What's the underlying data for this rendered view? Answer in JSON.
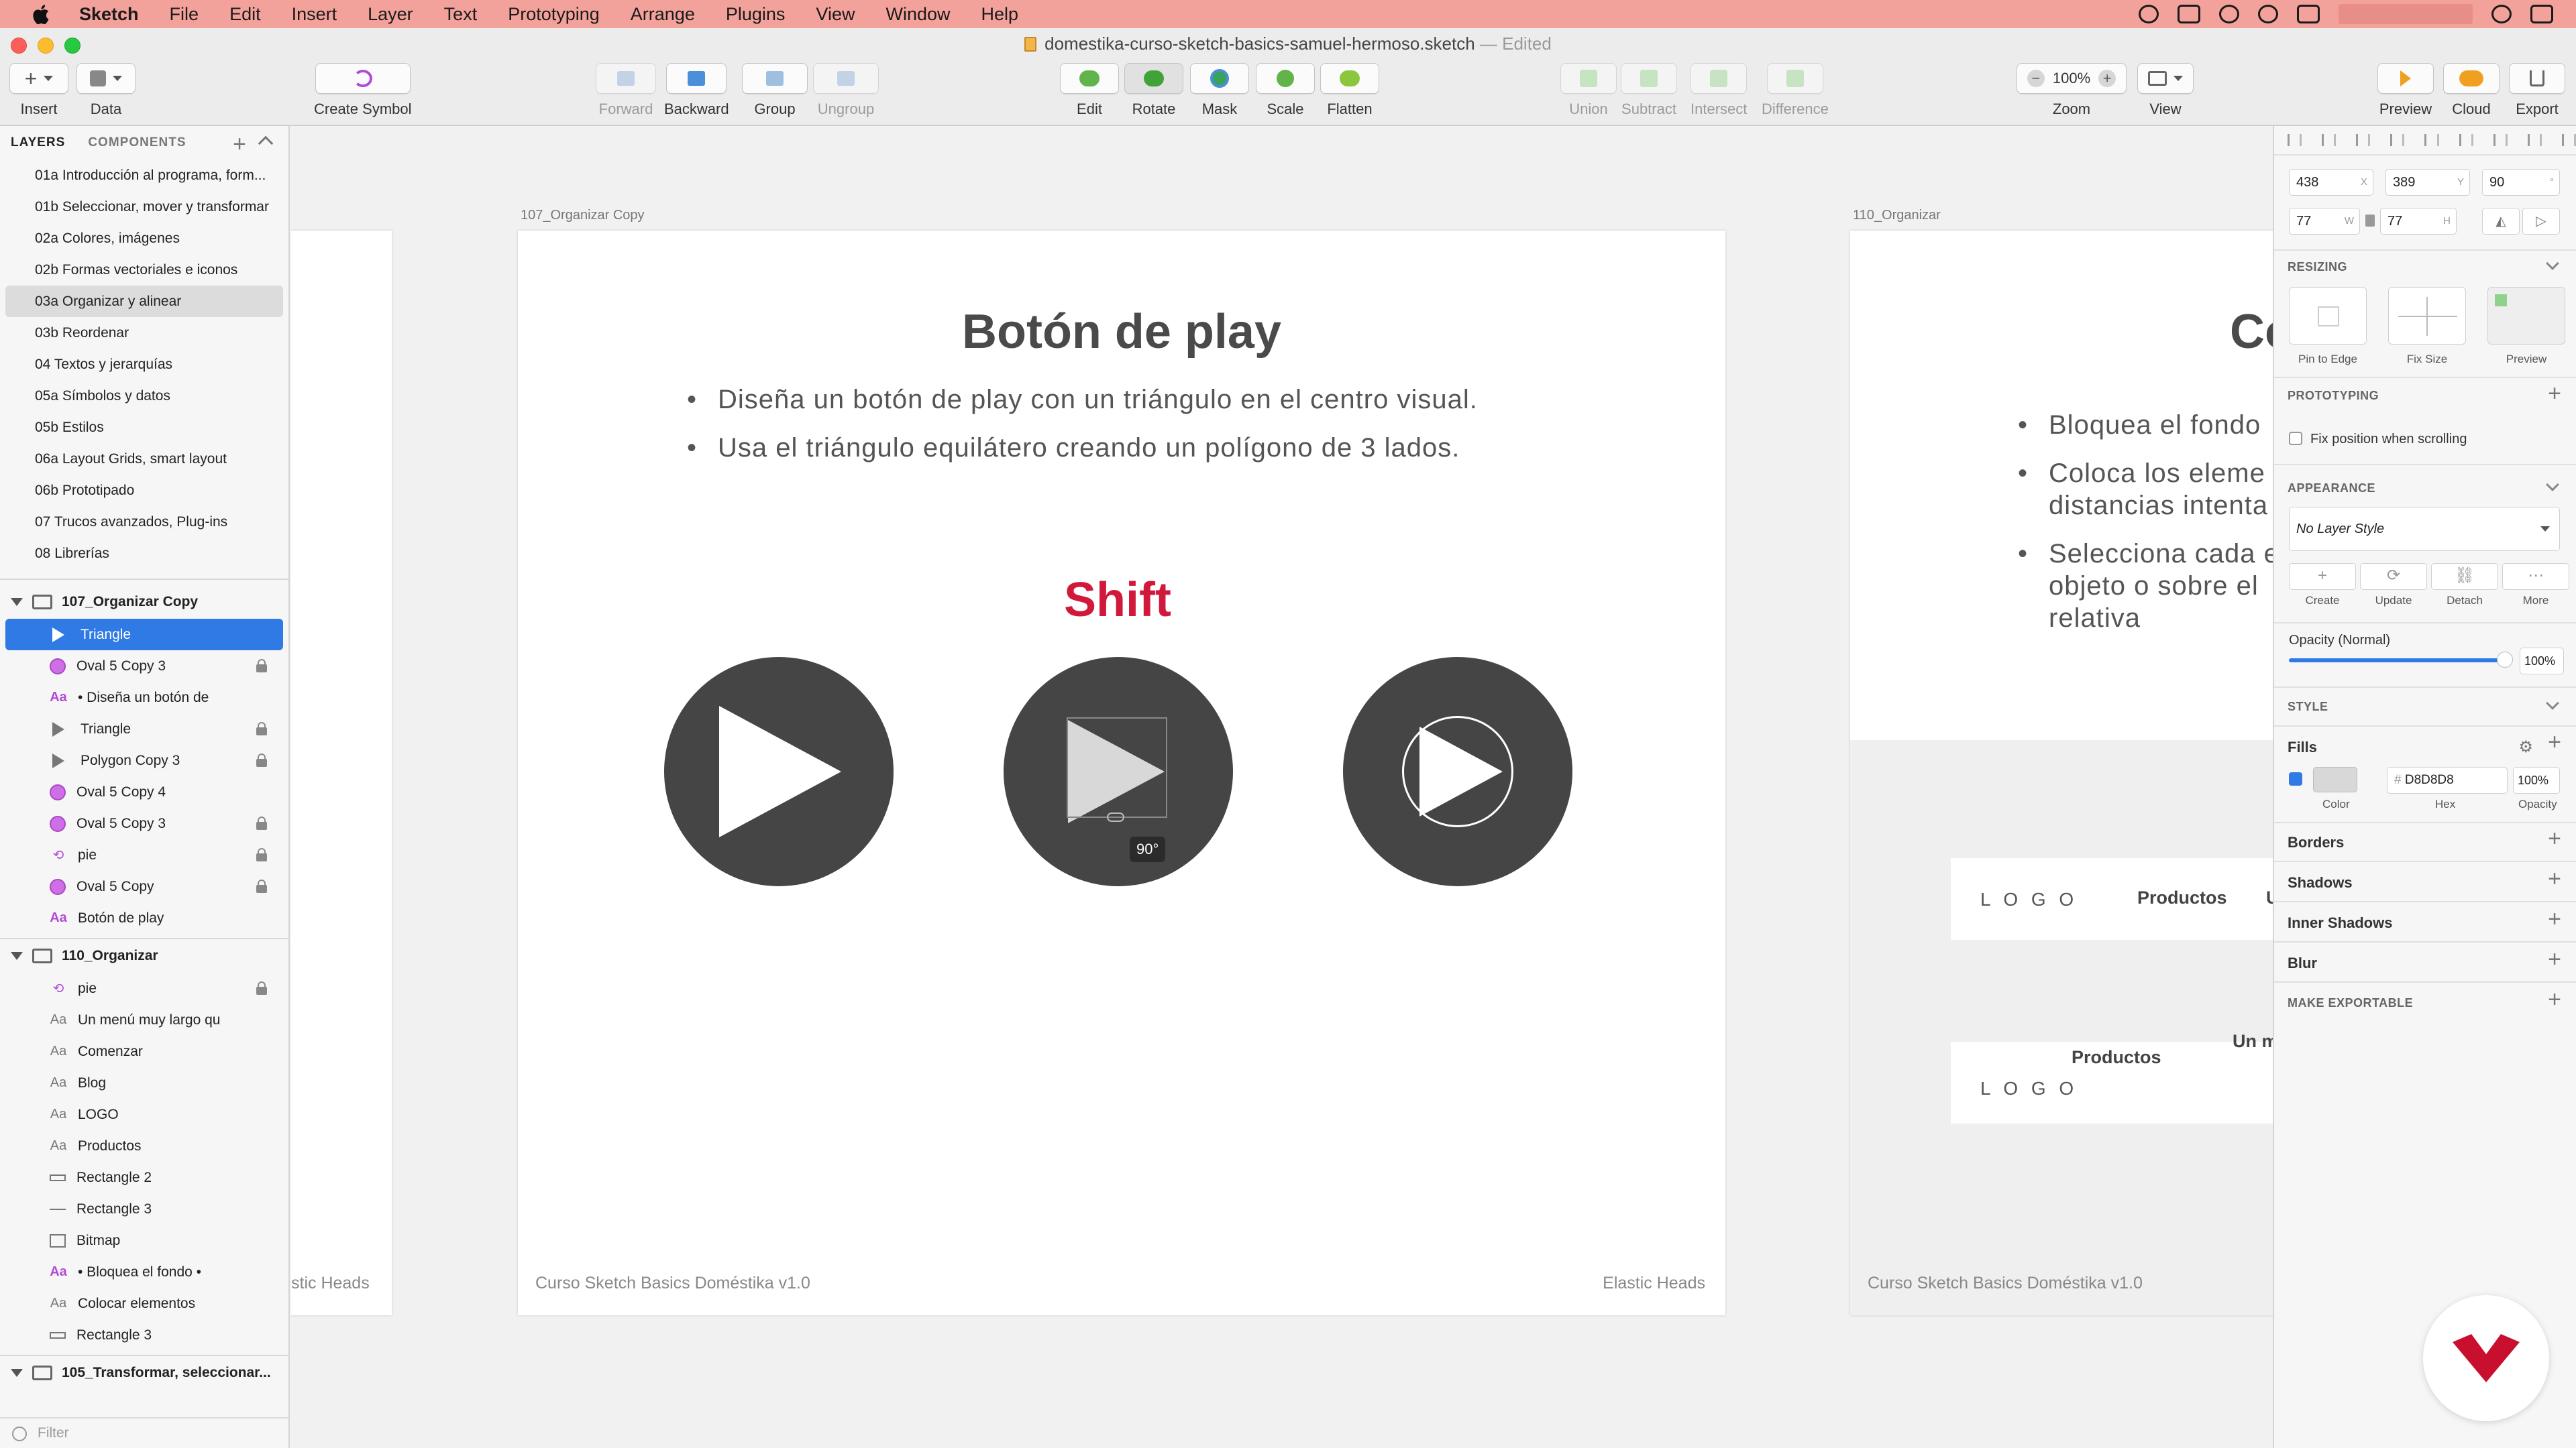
{
  "menubar": {
    "app": "Sketch",
    "items": [
      "File",
      "Edit",
      "Insert",
      "Layer",
      "Text",
      "Prototyping",
      "Arrange",
      "Plugins",
      "View",
      "Window",
      "Help"
    ]
  },
  "window": {
    "title": "domestika-curso-sketch-basics-samuel-hermoso.sketch",
    "edited": "— Edited"
  },
  "toolbar": {
    "insert": "Insert",
    "data": "Data",
    "create_symbol": "Create Symbol",
    "forward": "Forward",
    "backward": "Backward",
    "group": "Group",
    "ungroup": "Ungroup",
    "edit": "Edit",
    "rotate": "Rotate",
    "mask": "Mask",
    "scale": "Scale",
    "flatten": "Flatten",
    "union": "Union",
    "subtract": "Subtract",
    "intersect": "Intersect",
    "difference": "Difference",
    "zoom_value": "100%",
    "zoom": "Zoom",
    "view": "View",
    "preview": "Preview",
    "cloud": "Cloud",
    "export": "Export"
  },
  "sidebar": {
    "tab_layers": "LAYERS",
    "tab_components": "COMPONENTS",
    "pages": [
      "01a Introducción al programa, form...",
      "01b Seleccionar, mover y transformar",
      "02a Colores, imágenes",
      "02b Formas vectoriales e iconos",
      "03a Organizar y alinear",
      "03b Reordenar",
      "04 Textos y jerarquías",
      "05a Símbolos y datos",
      "05b Estilos",
      "06a Layout Grids, smart layout",
      "06b Prototipado",
      "07 Trucos avanzados, Plug-ins",
      "08 Librerías"
    ],
    "artboard1": {
      "name": "107_Organizar Copy",
      "layers": [
        {
          "name": "Triangle",
          "icon": "triangle-icon"
        },
        {
          "name": "Oval 5 Copy 3",
          "icon": "oval-icon"
        },
        {
          "name": "• Diseña un botón de",
          "icon": "text-icon"
        },
        {
          "name": "Triangle",
          "icon": "triangle-icon"
        },
        {
          "name": "Polygon Copy 3",
          "icon": "triangle-icon"
        },
        {
          "name": "Oval 5 Copy 4",
          "icon": "oval-icon"
        },
        {
          "name": "Oval 5 Copy 3",
          "icon": "oval-icon"
        },
        {
          "name": "pie",
          "icon": "symbol-icon"
        },
        {
          "name": "Oval 5 Copy",
          "icon": "oval-icon"
        },
        {
          "name": "Botón de play",
          "icon": "text-icon"
        }
      ]
    },
    "artboard2": {
      "name": "110_Organizar",
      "layers": [
        {
          "name": "pie",
          "icon": "symbol-icon"
        },
        {
          "name": "Un menú muy largo qu",
          "icon": "text-icon"
        },
        {
          "name": "Comenzar",
          "icon": "text-icon"
        },
        {
          "name": "Blog",
          "icon": "text-icon"
        },
        {
          "name": "LOGO",
          "icon": "text-icon"
        },
        {
          "name": "Productos",
          "icon": "text-icon"
        },
        {
          "name": "Rectangle 2",
          "icon": "rectangle-icon"
        },
        {
          "name": "Rectangle 3",
          "icon": "line-icon"
        },
        {
          "name": "Bitmap",
          "icon": "bitmap-icon"
        },
        {
          "name": "• Bloquea el fondo •",
          "icon": "text-icon"
        },
        {
          "name": "Colocar elementos",
          "icon": "text-icon"
        },
        {
          "name": "Rectangle 3",
          "icon": "rectangle-icon"
        }
      ]
    },
    "artboard3": {
      "name": "105_Transformar, seleccionar..."
    },
    "filter_placeholder": "Filter"
  },
  "canvas": {
    "left_footer": "stic Heads",
    "ab1": {
      "label": "107_Organizar Copy",
      "title": "Botón de play",
      "bullets": [
        "Diseña un botón de play con un triángulo en el centro visual.",
        "Usa el triángulo equilátero creando un polígono de 3 lados."
      ],
      "shift": "Shift",
      "rotation_tooltip": "90°",
      "footer_left": "Curso Sketch Basics Doméstika v1.0",
      "footer_right": "Elastic Heads"
    },
    "ab2": {
      "label": "110_Organizar",
      "title": "Co",
      "bullets": [
        "Bloquea el fondo",
        "Coloca los eleme",
        "distancias intenta",
        "Selecciona cada e",
        "objeto o sobre el",
        "relativa"
      ],
      "logo": "L O G O",
      "productos": "Productos",
      "u": "U",
      "logo2": "L O G O",
      "productos2": "Productos",
      "un_m": "Un m",
      "footer_left": "Curso Sketch Basics Doméstika v1.0"
    }
  },
  "inspector": {
    "x": "438",
    "x_suffix": "X",
    "y": "389",
    "y_suffix": "Y",
    "rotation": "90",
    "rotation_suffix": "°",
    "w": "77",
    "w_suffix": "W",
    "h": "77",
    "h_suffix": "H",
    "resizing": "RESIZING",
    "pin_to_edge": "Pin to Edge",
    "fix_size": "Fix Size",
    "preview": "Preview",
    "prototyping": "PROTOTYPING",
    "fix_position": "Fix position when scrolling",
    "appearance": "APPEARANCE",
    "layer_style": "No Layer Style",
    "create": "Create",
    "update": "Update",
    "detach": "Detach",
    "more": "More",
    "opacity_label": "Opacity (Normal)",
    "opacity_value": "100%",
    "style": "STYLE",
    "fills": "Fills",
    "fill_hex": "D8D8D8",
    "fill_opacity": "100%",
    "color_lbl": "Color",
    "hex_lbl": "Hex",
    "opacity_lbl": "Opacity",
    "borders": "Borders",
    "shadows": "Shadows",
    "inner_shadows": "Inner Shadows",
    "blur": "Blur",
    "make_exportable": "MAKE EXPORTABLE"
  },
  "colors": {
    "menubar": "#f3a19b",
    "selection": "#2f7ae5",
    "accent_red": "#d11a3b",
    "play_bg": "#454545",
    "fill": "#D8D8D8"
  }
}
